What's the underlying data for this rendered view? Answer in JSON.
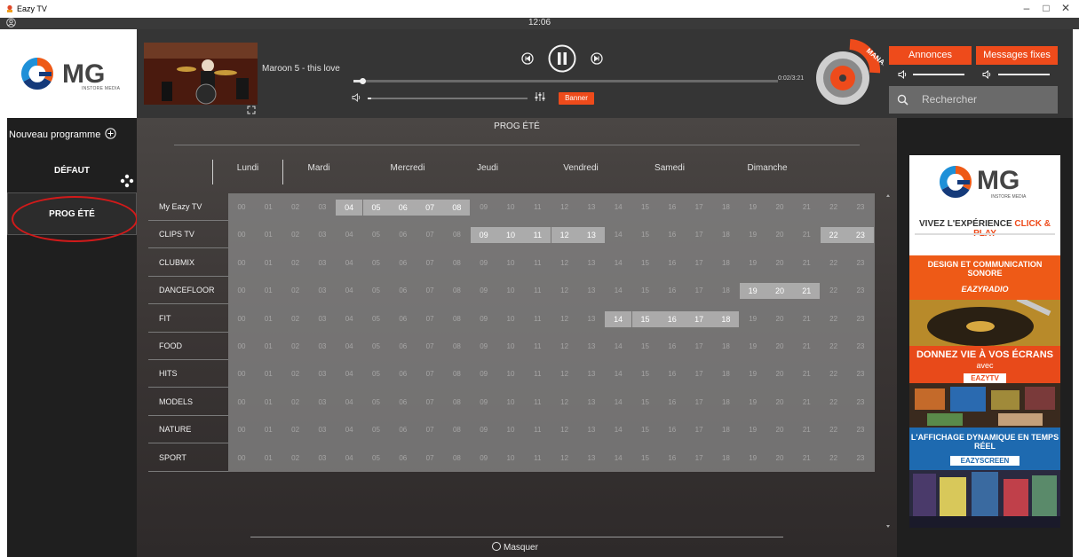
{
  "window": {
    "title": "Eazy TV",
    "controls": {
      "minimize": "–",
      "maximize": "□",
      "close": "✕"
    }
  },
  "topbar": {
    "clock": "12:06"
  },
  "logo": {
    "brand": "MG",
    "subtitle": "INSTORE MEDIA"
  },
  "player": {
    "track": "Maroon 5 - this love",
    "time": "0:02/3:21",
    "progress_fraction": 0.02,
    "volume_fraction": 0.02,
    "banner_label": "Banner"
  },
  "manager_badge": "MANAGER",
  "right_controls": {
    "annonces_label": "Annonces",
    "messages_label": "Messages fixes",
    "search_placeholder": "Rechercher",
    "annonces_volume_fraction": 1.0,
    "messages_volume_fraction": 1.0
  },
  "sidebar": {
    "new_program_label": "Nouveau programme",
    "programs": [
      {
        "label": "DÉFAUT",
        "active": false
      },
      {
        "label": "PROG ÉTÉ",
        "active": true
      }
    ]
  },
  "program": {
    "title": "PROG ÉTÉ",
    "days": [
      "Lundi",
      "Mardi",
      "Mercredi",
      "Jeudi",
      "Vendredi",
      "Samedi",
      "Dimanche"
    ],
    "active_day": "Lundi",
    "hours": [
      "00",
      "01",
      "02",
      "03",
      "04",
      "05",
      "06",
      "07",
      "08",
      "09",
      "10",
      "11",
      "12",
      "13",
      "14",
      "15",
      "16",
      "17",
      "18",
      "19",
      "20",
      "21",
      "22",
      "23"
    ],
    "channels": [
      {
        "name": "My Eazy TV",
        "active_hours": [
          4,
          5,
          6,
          7,
          8
        ]
      },
      {
        "name": "CLIPS TV",
        "active_hours": [
          9,
          10,
          11,
          12,
          13,
          22,
          23
        ]
      },
      {
        "name": "CLUBMIX",
        "active_hours": []
      },
      {
        "name": "DANCEFLOOR",
        "active_hours": [
          19,
          20,
          21
        ]
      },
      {
        "name": "FIT",
        "active_hours": [
          14,
          15,
          16,
          17,
          18
        ]
      },
      {
        "name": "FOOD",
        "active_hours": []
      },
      {
        "name": "HITS",
        "active_hours": []
      },
      {
        "name": "MODELS",
        "active_hours": []
      },
      {
        "name": "NATURE",
        "active_hours": []
      },
      {
        "name": "SPORT",
        "active_hours": []
      }
    ],
    "hide_label": "Masquer"
  },
  "ad": {
    "logo": "MG",
    "logo_sub": "INSTORE MEDIA",
    "headline_1": "VIVEZ L'EXPÉRIENCE",
    "headline_1b": "CLICK & PLAY",
    "band_1": "DESIGN ET COMMUNICATION SONORE",
    "band_1_brand": "EAZYRADIO",
    "band_2": "DONNEZ VIE À VOS ÉCRANS",
    "band_2_suffix": "avec",
    "band_2_brand": "EAZYTV",
    "band_3": "L'AFFICHAGE DYNAMIQUE EN TEMPS RÉEL",
    "band_3_brand": "EAZYSCREEN"
  },
  "colors": {
    "accent": "#ee4b1b",
    "highlight_ring": "#d11a1a"
  }
}
